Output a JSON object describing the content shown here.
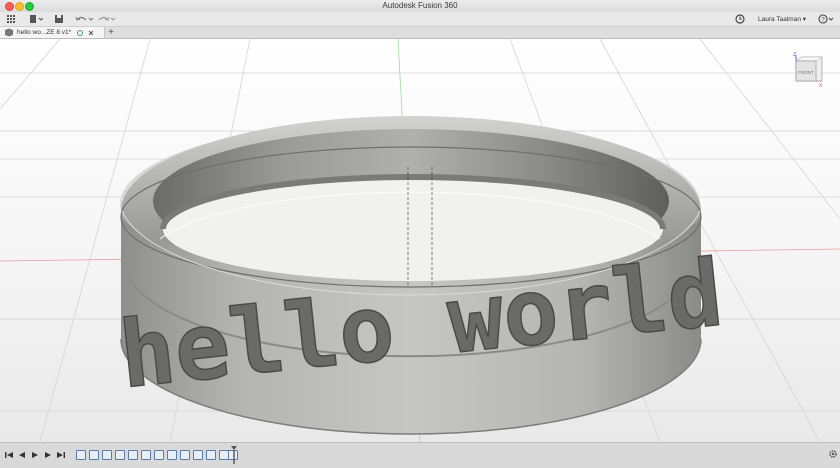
{
  "app": {
    "title": "Autodesk Fusion 360"
  },
  "toolbar": {
    "user_name": "Laura Taalman ▾",
    "icons": [
      "apps-grid-icon",
      "file-icon",
      "save-icon",
      "undo-icon",
      "redo-icon",
      "clock-icon",
      "help-icon"
    ]
  },
  "tabs": [
    {
      "label": "hello wo...ZE 8 v1*"
    }
  ],
  "canvas": {
    "engraved_text": "hello world",
    "viewcube_label": "FRONT",
    "axis_z": "Z",
    "axis_x": "X"
  },
  "colors": {
    "ring": "#a8a8a4",
    "grid": "#d2d2d2",
    "axis_red": "#e38a8a",
    "axis_green": "#8ed18e"
  }
}
